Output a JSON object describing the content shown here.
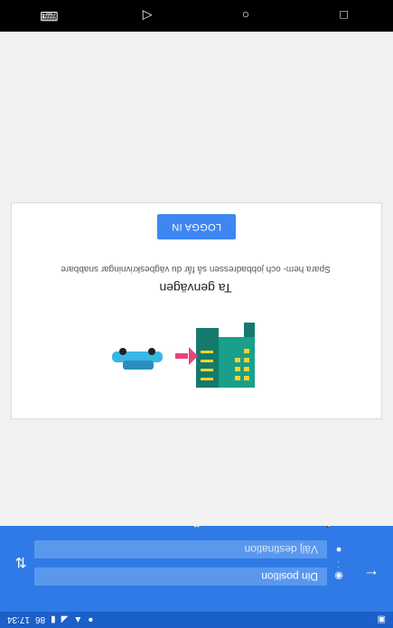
{
  "status_bar": {
    "time": "17:34",
    "battery": "86"
  },
  "directions": {
    "origin_label": "Din position",
    "destination_placeholder": "Välj destination"
  },
  "card": {
    "title": "Ta genvägen",
    "description": "Spara hem- och jobbadressen så får du vägbeskrivningar snabbare",
    "login_label": "LOGGA IN"
  },
  "colors": {
    "primary": "#2f7ae6",
    "button": "#3e86f2"
  }
}
